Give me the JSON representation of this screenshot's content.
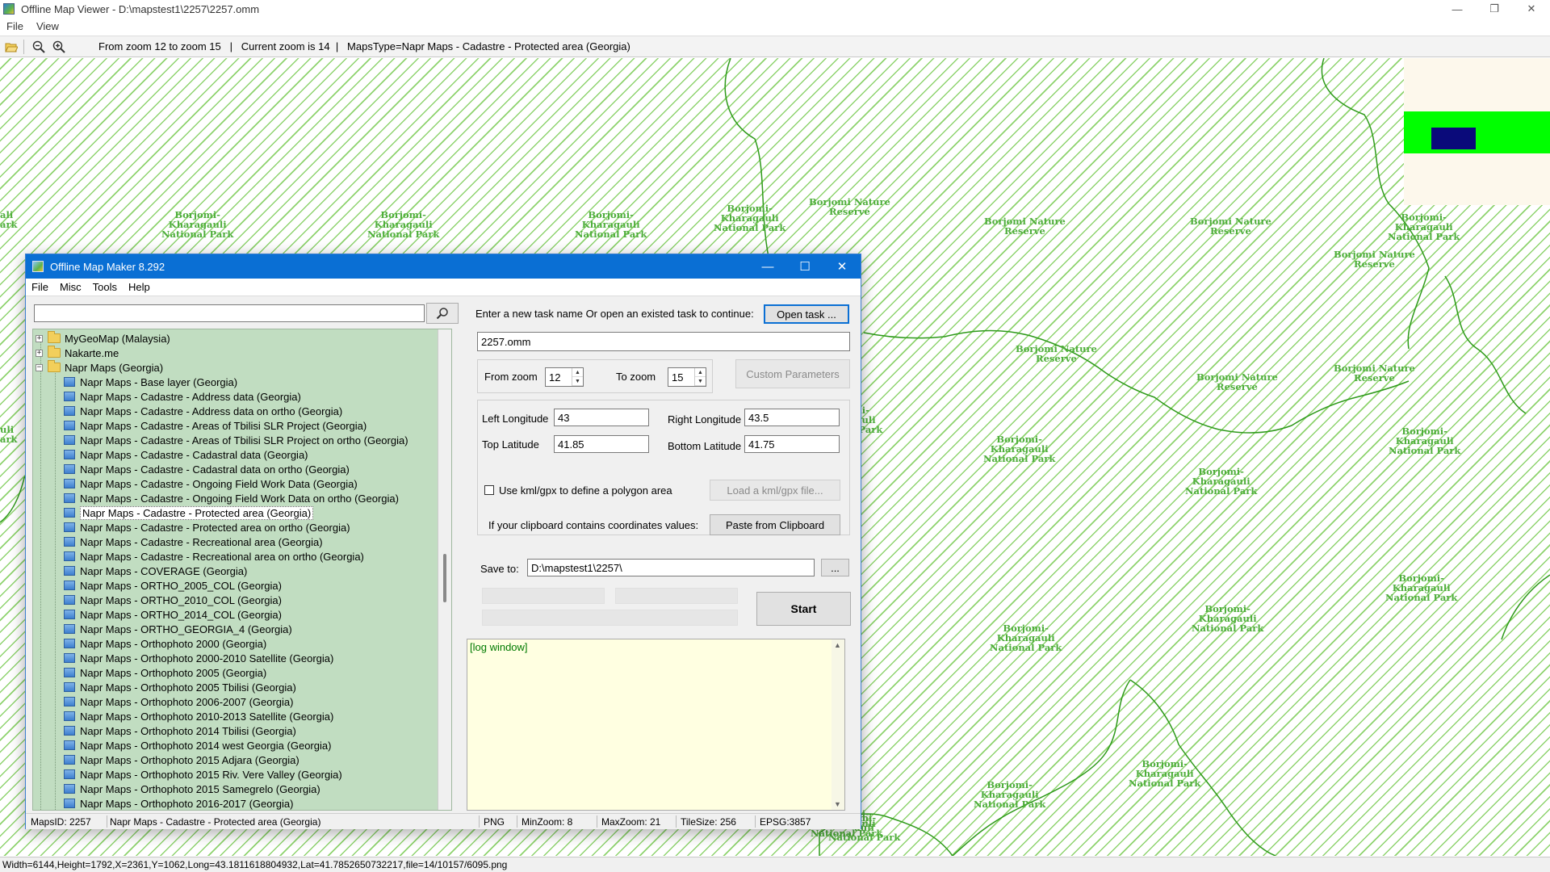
{
  "window": {
    "title": "Offline Map Viewer - D:\\mapstest1\\2257\\2257.omm",
    "controls": [
      "—",
      "❐",
      "✕"
    ]
  },
  "menu": [
    "File",
    "View"
  ],
  "toolbar": {
    "info": "From zoom 12 to zoom 15   |   Current zoom is 14  |   MapsType=Napr Maps - Cadastre - Protected area (Georgia)"
  },
  "map_labels": [
    {
      "text": "Borjomi-\nKharagauli\nNational Park"
    },
    {
      "text": "Borjomi-\nKharagauli\nNational Park"
    },
    {
      "text": "Borjomi-\nKharagauli\nNational Park"
    },
    {
      "text": "Borjomi-\nKharagauli\nNational Park"
    },
    {
      "text": "Borjomi Nature\nReserve"
    },
    {
      "text": "Borjomi Nature\nReserve"
    },
    {
      "text": "Borjomi Nature\nReserve"
    },
    {
      "text": "Borjomi-\nKharagauli\nNational Park"
    },
    {
      "text": "Borjomi Nature\nReserve"
    },
    {
      "text": "Borjomi Nature\nReserve"
    },
    {
      "text": "Borjomi Nature\nReserve"
    },
    {
      "text": "Borjomi Nature\nReserve"
    },
    {
      "text": "Borjomi-\nKharagauli\nNational Park"
    },
    {
      "text": "Borjomi-\nKharagauli\nNational Park"
    },
    {
      "text": "Borjomi-\nKharagauli\nNational Park"
    },
    {
      "text": "Borjomi-\nKharagauli\nNational Park"
    },
    {
      "text": "Borjomi-\nKharagauli\nNational Park"
    },
    {
      "text": "Borjomi-\nKharagauli\nNational Park"
    },
    {
      "text": "Borjomi-\nKharagauli\nNational Park"
    },
    {
      "text": "Borjomi-\nKharagauli\nNational Park"
    },
    {
      "text": "Borjomi-\nKharagauli\nNational Park"
    },
    {
      "text": "Borjomi-\nKharagauli\nNational Park"
    },
    {
      "text": "ali\nark"
    },
    {
      "text": "uli\nark"
    },
    {
      "text": "omi-\nauli\nNational Park"
    }
  ],
  "status": {
    "text": "Width=6144,Height=1792,X=2361,Y=1062,Long=43.1811618804932,Lat=41.7852650732217,file=14/10157/6095.png"
  },
  "dialog": {
    "title": "Offline Map Maker 8.292",
    "controls": [
      "—",
      "☐",
      "✕"
    ],
    "menu": [
      "File",
      "Misc",
      "Tools",
      "Help"
    ],
    "search": {
      "value": "",
      "placeholder": ""
    },
    "tree": {
      "folders": [
        {
          "label": "MyGeoMap (Malaysia)",
          "expander": "+"
        },
        {
          "label": "Nakarte.me",
          "expander": "+"
        },
        {
          "label": "Napr Maps (Georgia)",
          "expander": "−"
        }
      ],
      "items": [
        "Napr Maps - Base layer (Georgia)",
        "Napr Maps - Cadastre - Address data (Georgia)",
        "Napr Maps - Cadastre - Address data on ortho (Georgia)",
        "Napr Maps - Cadastre - Areas of Tbilisi SLR Project (Georgia)",
        "Napr Maps - Cadastre - Areas of Tbilisi SLR Project on ortho (Georgia)",
        "Napr Maps - Cadastre - Cadastral data (Georgia)",
        "Napr Maps - Cadastre - Cadastral data on ortho (Georgia)",
        "Napr Maps - Cadastre - Ongoing Field Work Data (Georgia)",
        "Napr Maps - Cadastre - Ongoing Field Work Data on ortho (Georgia)",
        "Napr Maps - Cadastre - Protected area (Georgia)",
        "Napr Maps - Cadastre - Protected area on ortho (Georgia)",
        "Napr Maps - Cadastre - Recreational area (Georgia)",
        "Napr Maps - Cadastre - Recreational area on ortho (Georgia)",
        "Napr Maps - COVERAGE (Georgia)",
        "Napr Maps - ORTHO_2005_COL (Georgia)",
        "Napr Maps - ORTHO_2010_COL (Georgia)",
        "Napr Maps - ORTHO_2014_COL (Georgia)",
        "Napr Maps - ORTHO_GEORGIA_4 (Georgia)",
        "Napr Maps - Orthophoto 2000 (Georgia)",
        "Napr Maps - Orthophoto 2000-2010 Satellite (Georgia)",
        "Napr Maps - Orthophoto 2005 (Georgia)",
        "Napr Maps - Orthophoto 2005 Tbilisi (Georgia)",
        "Napr Maps - Orthophoto 2006-2007 (Georgia)",
        "Napr Maps - Orthophoto 2010-2013 Satellite (Georgia)",
        "Napr Maps - Orthophoto 2014 Tbilisi (Georgia)",
        "Napr Maps - Orthophoto 2014 west Georgia (Georgia)",
        "Napr Maps - Orthophoto 2015 Adjara (Georgia)",
        "Napr Maps - Orthophoto 2015 Riv. Vere Valley (Georgia)",
        "Napr Maps - Orthophoto 2015 Samegrelo (Georgia)",
        "Napr Maps - Orthophoto 2016-2017 (Georgia)"
      ],
      "selected_index": 9
    },
    "task_prompt": "Enter a new task name Or open an existed task to continue:",
    "open_task_label": "Open task ...",
    "task_name": "2257.omm",
    "from_zoom_label": "From zoom",
    "from_zoom": "12",
    "to_zoom_label": "To zoom",
    "to_zoom": "15",
    "custom_params_label": "Custom Parameters",
    "left_lon_label": "Left Longitude",
    "left_lon": "43",
    "right_lon_label": "Right Longitude",
    "right_lon": "43.5",
    "top_lat_label": "Top Latitude",
    "top_lat": "41.85",
    "bottom_lat_label": "Bottom Latitude",
    "bottom_lat": "41.75",
    "kml_label": "Use kml/gpx to define a polygon area",
    "kml_button": "Load a kml/gpx file...",
    "clipboard_label": "If your clipboard contains coordinates values:",
    "paste_button": "Paste from Clipboard",
    "save_to_label": "Save to:",
    "save_to": "D:\\mapstest1\\2257\\",
    "browse_label": "...",
    "start_label": "Start",
    "log_text": "[log window]",
    "status": {
      "maps_id": "MapsID: 2257",
      "maps_name": "Napr Maps - Cadastre - Protected area (Georgia)",
      "format": "PNG",
      "min_zoom": "MinZoom: 8",
      "max_zoom": "MaxZoom: 21",
      "tile_size": "TileSize: 256",
      "epsg": "EPSG:3857"
    }
  }
}
